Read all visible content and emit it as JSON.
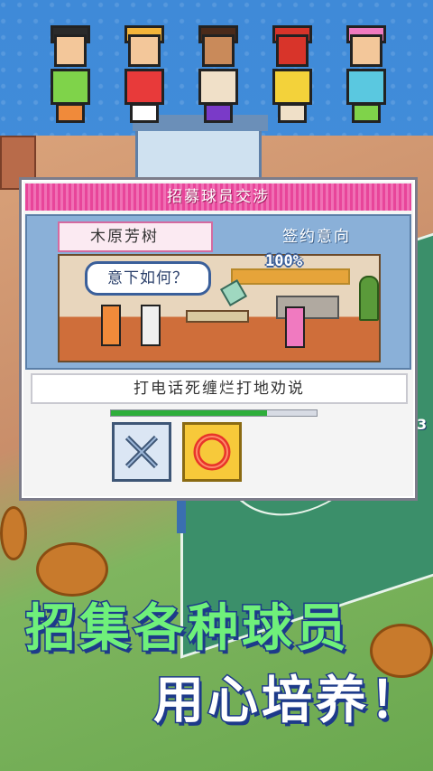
{
  "dialog": {
    "title": "招募球员交涉",
    "player_name": "木原芳树",
    "intent_label": "签约意向",
    "speech_bubble": "意下如何？",
    "intent_percent_text": "100%",
    "intent_level": 1.0,
    "option_text": "打电话死缠烂打地劝说",
    "option_progress": 0.76,
    "cancel_icon": "cross-icon",
    "confirm_icon": "circle-icon"
  },
  "side_number": "3",
  "slogan": {
    "line1": "招集各种球员",
    "line2": "用心培养！"
  },
  "colors": {
    "title_bar": "#e8459a",
    "progress": "#2eae3a",
    "slogan_green": "#6ff07a",
    "confirm_button": "#f7c93a"
  }
}
